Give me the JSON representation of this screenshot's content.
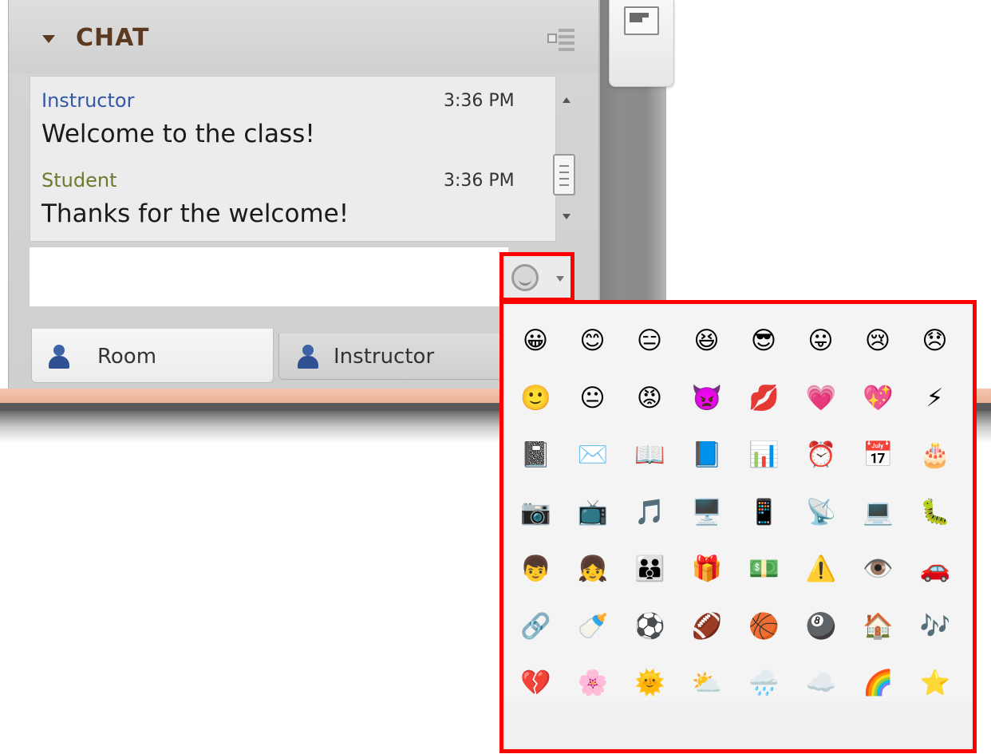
{
  "chat": {
    "title": "CHAT",
    "messages": [
      {
        "name": "Instructor",
        "name_color": "#3557a7",
        "time": "3:36 PM",
        "text": "Welcome to the class!"
      },
      {
        "name": "Student",
        "name_color": "#6a7a2e",
        "time": "3:36 PM",
        "text": "Thanks for the welcome!"
      }
    ],
    "input": {
      "value": "",
      "placeholder": ""
    },
    "emoji_button_icon": "smiley-icon"
  },
  "tabs": [
    {
      "label": "Room",
      "icon": "user-icon",
      "selected": true
    },
    {
      "label": "Instructor",
      "icon": "user-icon",
      "selected": false
    }
  ],
  "emoji_palette": {
    "rows": [
      [
        "😀",
        "😊",
        "😑",
        "😆",
        "😎",
        "😛",
        "😢",
        "😞"
      ],
      [
        "🙂",
        "😐",
        "😡",
        "👿",
        "💋",
        "💗",
        "💖",
        "⚡"
      ],
      [
        "📓",
        "✉️",
        "📖",
        "📘",
        "📊",
        "⏰",
        "📅",
        "🎂"
      ],
      [
        "📷",
        "📺",
        "🎵",
        "🖥️",
        "📱",
        "📡",
        "💻",
        "🐛"
      ],
      [
        "👦",
        "👧",
        "👪",
        "🎁",
        "💵",
        "⚠️",
        "👁️",
        "🚗"
      ],
      [
        "🔗",
        "🍼",
        "⚽",
        "🏈",
        "🏀",
        "🎱",
        "🏠",
        "🎶"
      ],
      [
        "💔",
        "🌸",
        "🌞",
        "⛅",
        "🌧️",
        "☁️",
        "🌈",
        "⭐"
      ]
    ],
    "highlight_color": "#ff0000"
  }
}
